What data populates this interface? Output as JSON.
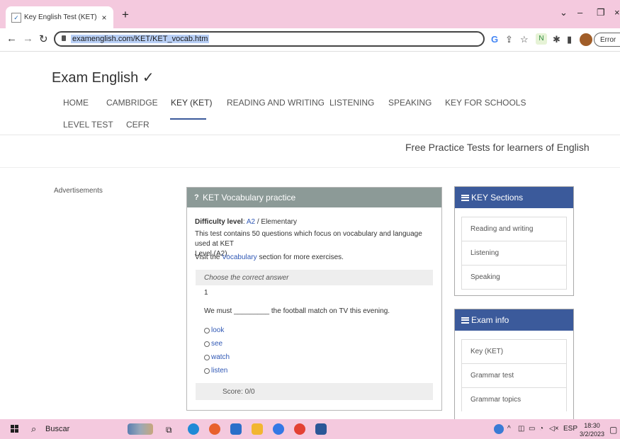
{
  "browser": {
    "tab_title": "Key English Test (KET) - free voca",
    "url": "examenglish.com/KET/KET_vocab.htm",
    "error_label": "Error"
  },
  "site": {
    "logo": "Exam English ✓",
    "nav": [
      "HOME",
      "CAMBRIDGE",
      "KEY (KET)",
      "READING AND WRITING",
      "LISTENING",
      "SPEAKING",
      "KEY FOR SCHOOLS",
      "LEVEL TEST",
      "CEFR"
    ],
    "active_nav": "KEY (KET)",
    "tagline": "Free Practice Tests for learners of English"
  },
  "ads_label": "Advertisements",
  "practice": {
    "heading": "KET Vocabulary practice",
    "difficulty_label": "Difficulty level",
    "difficulty_level": "A2",
    "difficulty_desc": "/ Elementary",
    "desc_line1": "This test contains 50 questions which focus on vocabulary and language used at KET",
    "desc_line2": "Level (A2).",
    "visit_pre": "Visit the",
    "visit_link": "Vocabulary",
    "visit_post": "section for more exercises.",
    "instruction": "Choose the correct answer",
    "question_number": "1",
    "question_pre": "We must",
    "question_blank": "_________",
    "question_post": "the football match on TV this evening.",
    "options": [
      "look",
      "see",
      "watch",
      "listen"
    ],
    "score": "Score: 0/0"
  },
  "key_sections": {
    "title": "KEY Sections",
    "items": [
      "Reading and writing",
      "Listening",
      "Speaking"
    ]
  },
  "exam_info": {
    "title": "Exam info",
    "items": [
      "Key (KET)",
      "Grammar test",
      "Grammar topics"
    ]
  },
  "taskbar": {
    "search_label": "Buscar",
    "lang": "ESP",
    "time": "18:30",
    "date": "3/2/2023"
  },
  "colors": {
    "accent": "#3b5a9b",
    "panel_header": "#8c9a97",
    "browser_frame": "#f4c9de",
    "link": "#3058b5"
  }
}
